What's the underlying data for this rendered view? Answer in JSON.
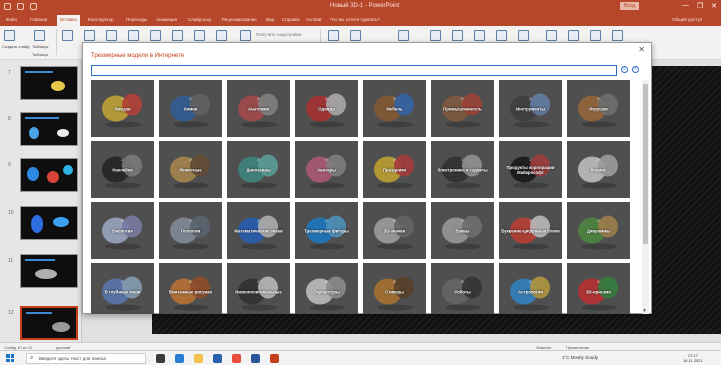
{
  "window": {
    "title": "Новый 3D-1 - PowerPoint",
    "signin": "Вход",
    "controls": [
      "—",
      "❐",
      "✕"
    ]
  },
  "menu": {
    "tabs": [
      "Файл",
      "Главная",
      "Вставка",
      "Конструктор",
      "Переходы",
      "Анимация",
      "Слайд-шоу",
      "Рецензирование",
      "Вид",
      "Справка",
      "Acrobat",
      "Что вы хотите сделать?"
    ],
    "active_index": 2,
    "share": "Общий доступ"
  },
  "ribbon": {
    "labels": [
      "Создать слайд",
      "Таблицы",
      "Таблица"
    ],
    "link_text": "Получить надстройки"
  },
  "slides": {
    "numbers": [
      "7",
      "8",
      "9",
      "10",
      "11",
      "12"
    ]
  },
  "dialog": {
    "title": "Трехмерные модели в Интернете",
    "close": "✕",
    "search_value": "",
    "tiles": [
      [
        "Эмодзи",
        "Химия",
        "Анатомия",
        "Одежда",
        "Мебель",
        "Промышленность",
        "Инструменты",
        "Игрушки"
      ],
      [
        "Наклейки",
        "Животные",
        "Динозавры",
        "Аватары",
        "Праздники",
        "Электроника и гаджеты",
        "Продукты корпорации Майкрософт",
        "Космос"
      ],
      [
        "Биология",
        "Геология",
        "Математические знаки",
        "Трехмерные фигуры",
        "3D-значки",
        "Буквы",
        "Буквенно-цифровые блоки",
        "Диораммы"
      ],
      [
        "В глубинах моря",
        "Винтажные рисунки",
        "Низкополигональные",
        "Скульптуры",
        "Стикеры",
        "Роботы",
        "Астрология",
        "3D-оригами"
      ]
    ]
  },
  "statusbar": {
    "left": "Слайд 10 из 12",
    "lang": "русский",
    "notes": "Заметки",
    "comments": "Примечания"
  },
  "taskbar": {
    "search_placeholder": "Введите здесь текст для поиска",
    "weather": "1°C Mostly cloudy",
    "time": "17:17",
    "date": "16.11.2021"
  }
}
